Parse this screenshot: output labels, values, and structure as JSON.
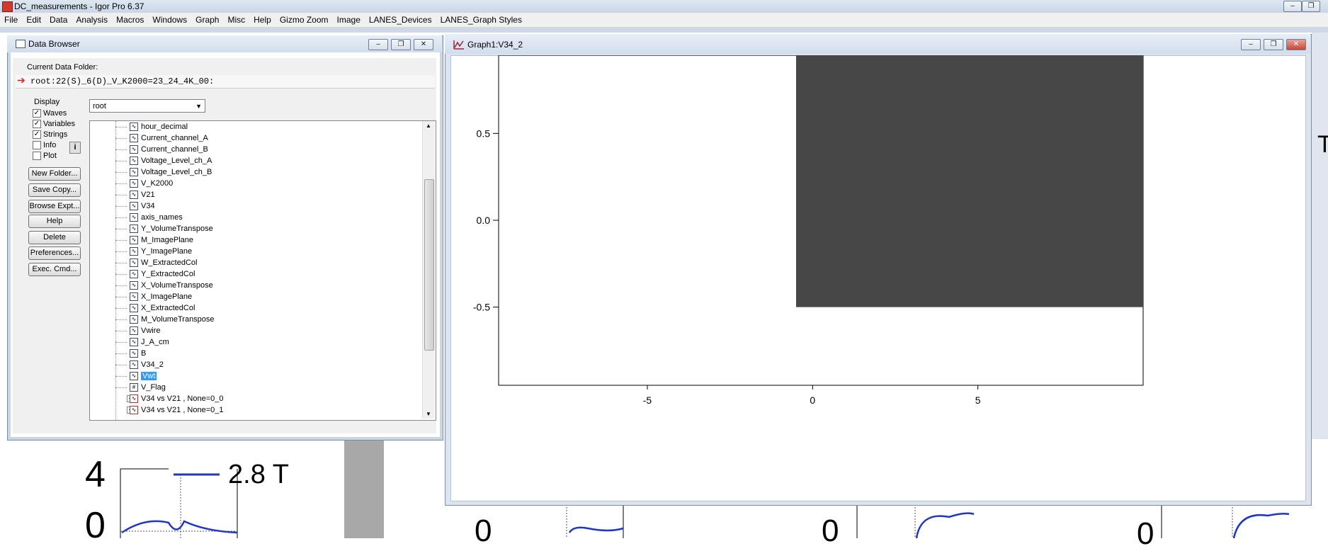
{
  "app": {
    "title": "DC_measurements - Igor Pro 6.37"
  },
  "menu": [
    "File",
    "Edit",
    "Data",
    "Analysis",
    "Macros",
    "Windows",
    "Graph",
    "Misc",
    "Help",
    "Gizmo Zoom",
    "Image",
    "LANES_Devices",
    "LANES_Graph Styles"
  ],
  "data_browser": {
    "title": "Data Browser",
    "current_folder_label": "Current Data Folder:",
    "current_folder_path": "root:22(S)_6(D)_V_K2000=23_24_4K_00:",
    "display_label": "Display",
    "checks": [
      {
        "label": "Waves",
        "checked": true
      },
      {
        "label": "Variables",
        "checked": true
      },
      {
        "label": "Strings",
        "checked": true
      },
      {
        "label": "Info",
        "checked": false
      },
      {
        "label": "Plot",
        "checked": false
      }
    ],
    "info_icon": "i",
    "buttons": [
      "New Folder...",
      "Save Copy...",
      "Browse Expt...",
      "Help",
      "Delete",
      "Preferences...",
      "Exec. Cmd..."
    ],
    "folder_select": "root",
    "items": [
      "hour_decimal",
      "Current_channel_A",
      "Current_channel_B",
      "Voltage_Level_ch_A",
      "Voltage_Level_ch_B",
      "V_K2000",
      "V21",
      "V34",
      "axis_names",
      "Y_VolumeTranspose",
      "M_ImagePlane",
      "Y_ImagePlane",
      "W_ExtractedCol",
      "Y_ExtractedCol",
      "X_VolumeTranspose",
      "X_ImagePlane",
      "X_ExtractedCol",
      "M_VolumeTranspose",
      "Vwire",
      "J_A_cm",
      "B",
      "V34_2",
      "Vwt",
      "V_Flag"
    ],
    "selected_item": "Vwt",
    "folders": [
      "V34 vs V21  , None=0_0",
      "V34 vs V21  , None=0_1"
    ]
  },
  "graph": {
    "title": "Graph1:V34_2",
    "accent": "#474747"
  },
  "background": {
    "big_y_4": "4",
    "big_y_0": "0",
    "legend": "2.8 T",
    "zero_a": "0",
    "zero_b": "0",
    "zero_c": "0",
    "right_letter": "T"
  },
  "chart_data": {
    "type": "heatmap",
    "xlim": [
      -9.5,
      10
    ],
    "ylim": [
      -0.95,
      0.95
    ],
    "x_ticks": [
      -5,
      0,
      5
    ],
    "y_ticks": [
      0.5,
      0.0,
      -0.5
    ],
    "x_tick_labels": [
      "-5",
      "0",
      "5"
    ],
    "y_tick_labels": [
      "0.5",
      "0.0",
      "-0.5"
    ],
    "image_extent": {
      "x": [
        -0.5,
        10
      ],
      "y": [
        -0.5,
        0.95
      ]
    },
    "image_color": "#474747",
    "grid": false
  }
}
